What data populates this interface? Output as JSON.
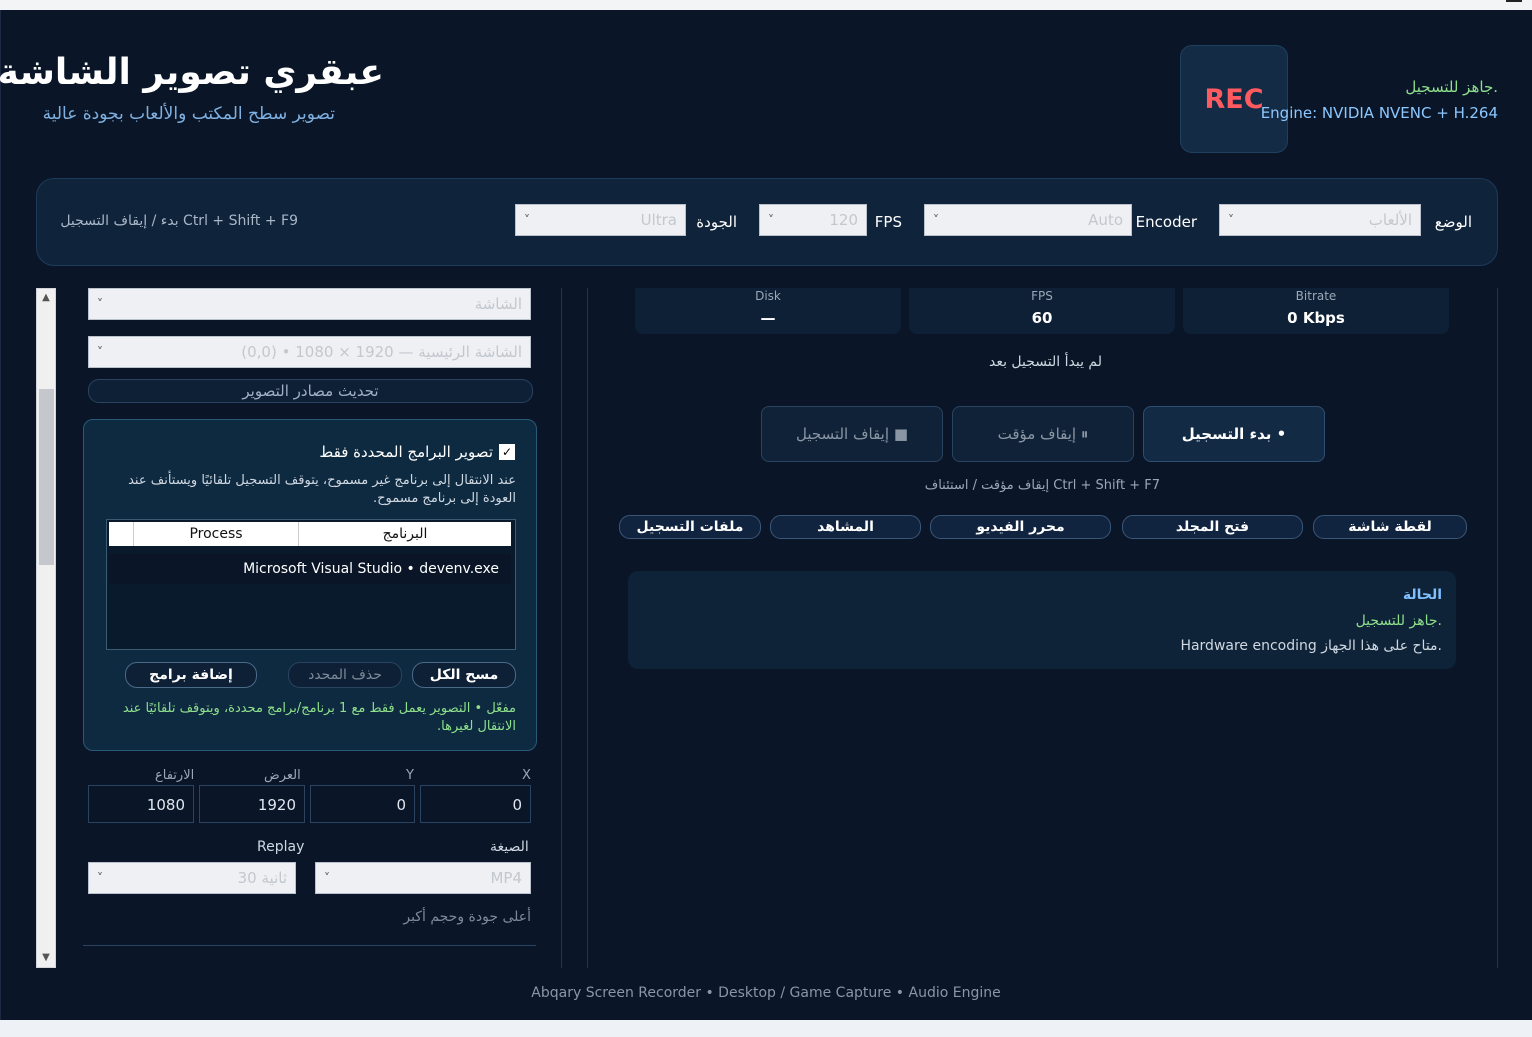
{
  "header": {
    "title": "عبقري تصوير الشاشة",
    "subtitle": "تصوير سطح المكتب والألعاب بجودة عالية",
    "rec_label": "REC",
    "status": "جاهز للتسجيل.",
    "engine": "Engine: NVIDIA NVENC + H.264"
  },
  "toolbar": {
    "mode_label": "الوضع",
    "mode_value": "الألعاب",
    "encoder_label": "Encoder",
    "encoder_value": "Auto",
    "fps_label": "FPS",
    "fps_value": "120",
    "quality_label": "الجودة",
    "quality_value": "Ultra",
    "hotkey_hint": "بدء / إيقاف التسجيل  Ctrl + Shift + F9"
  },
  "left": {
    "source_value": "الشاشة",
    "monitor_value": "الشاشة الرئيسية — 1920 × 1080 • (0,0)",
    "refresh_button": "تحديث مصادر التصوير",
    "only_selected_label": "تصوير البرامج المحددة فقط",
    "only_selected_checked": true,
    "only_selected_desc": "عند الانتقال إلى برنامج غير مسموح، يتوقف التسجيل تلقائيًا ويستأنف عند العودة إلى برنامج مسموح.",
    "table_headers": [
      "البرنامج",
      "Process"
    ],
    "table_rows": [
      "Microsoft Visual Studio • devenv.exe"
    ],
    "clear_all": "مسح الكل",
    "delete_selected": "حذف المحدد",
    "add_programs": "إضافة برامج",
    "active_note": "مفعّل • التصوير يعمل فقط مع 1 برنامج/برامج محددة، ويتوقف تلقائيًا عند الانتقال لغيرها.",
    "x_label": "X",
    "x_value": "0",
    "y_label": "Y",
    "y_value": "0",
    "w_label": "العرض",
    "w_value": "1920",
    "h_label": "الارتفاع",
    "h_value": "1080",
    "format_label": "الصيغة",
    "format_value": "MP4",
    "replay_label": "Replay",
    "replay_value": "30 ثانية",
    "quality_hint": "أعلى جودة وحجم أكبر"
  },
  "right": {
    "stats": [
      {
        "key": "Bitrate",
        "value": "0 Kbps"
      },
      {
        "key": "FPS",
        "value": "60"
      },
      {
        "key": "Disk",
        "value": "—"
      }
    ],
    "not_started": "لم يبدأ التسجيل بعد",
    "start_button": "بدء التسجيل",
    "pause_button": "إيقاف مؤقت",
    "stop_button": "إيقاف التسجيل",
    "pause_hint": "إيقاف مؤقت / استئناف  Ctrl + Shift + F7",
    "actions": [
      "لقطة شاشة",
      "فتح المجلد",
      "محرر الفيديو",
      "المشاهد",
      "ملفات التسجيل"
    ],
    "status_title": "الحالة",
    "status_line1": "جاهز للتسجيل.",
    "status_line2": "Hardware encoding متاح على هذا الجهاز."
  },
  "footer": "Abqary Screen Recorder • Desktop / Game Capture • Audio Engine",
  "colors": {
    "accent_rec": "#ff5a5f",
    "ready_green": "#8ee08b",
    "link_blue": "#8cc8ff",
    "bg": "#0a1628"
  }
}
